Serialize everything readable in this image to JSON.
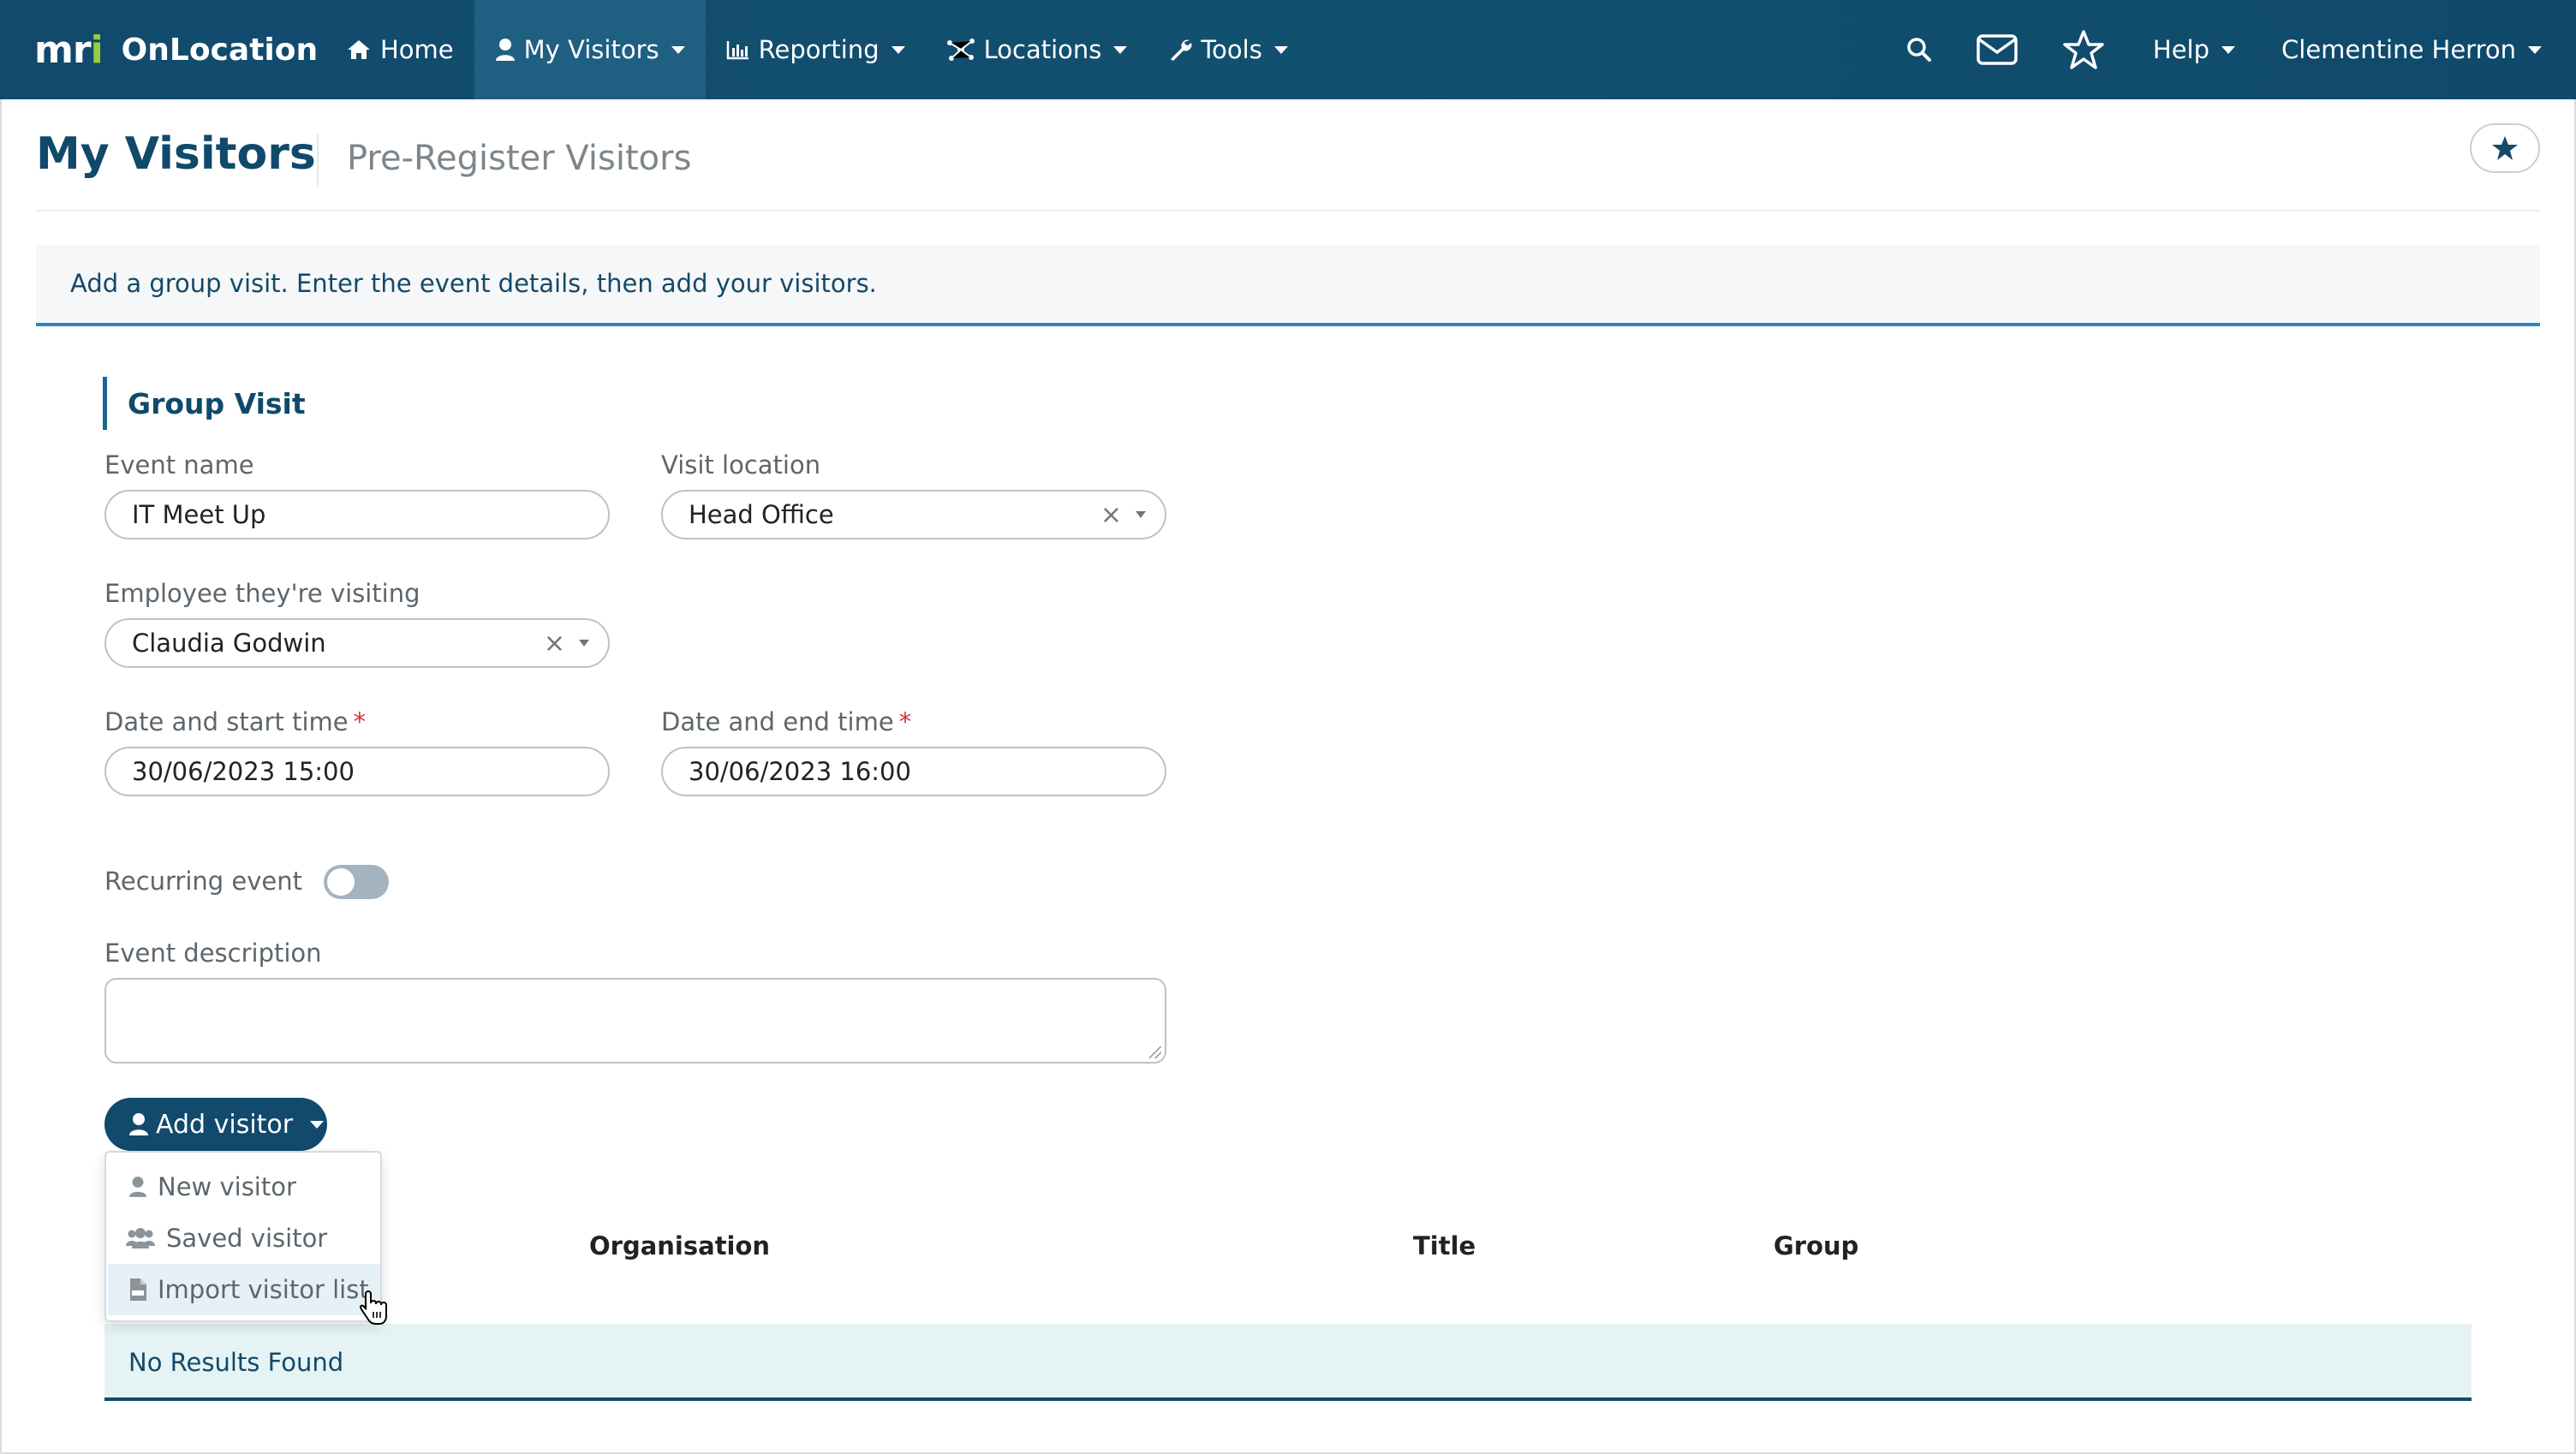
{
  "brand": {
    "logo_text": "mri",
    "name": "OnLocation"
  },
  "nav": {
    "items": [
      {
        "label": "Home",
        "icon": "home-icon"
      },
      {
        "label": "My Visitors",
        "icon": "user-icon",
        "active": true
      },
      {
        "label": "Reporting",
        "icon": "bar-chart-icon"
      },
      {
        "label": "Locations",
        "icon": "network-icon"
      },
      {
        "label": "Tools",
        "icon": "wrench-icon"
      }
    ],
    "help_label": "Help",
    "user_label": "Clementine Herron"
  },
  "header": {
    "title": "My Visitors",
    "subtitle": "Pre-Register Visitors"
  },
  "banner": {
    "text": "Add a group visit. Enter the event details, then add your visitors."
  },
  "form": {
    "section_title": "Group Visit",
    "event_name": {
      "label": "Event name",
      "value": "IT Meet Up"
    },
    "visit_location": {
      "label": "Visit location",
      "value": "Head Office"
    },
    "employee": {
      "label": "Employee they're visiting",
      "value": "Claudia Godwin"
    },
    "start": {
      "label": "Date and start time",
      "required_mark": "*",
      "value": "30/06/2023 15:00"
    },
    "end": {
      "label": "Date and end time",
      "required_mark": "*",
      "value": "30/06/2023 16:00"
    },
    "recurring": {
      "label": "Recurring event",
      "on": false
    },
    "description": {
      "label": "Event description",
      "value": ""
    }
  },
  "add_visitor": {
    "label": "Add visitor",
    "menu": [
      {
        "label": "New visitor",
        "icon": "user-icon"
      },
      {
        "label": "Saved visitor",
        "icon": "users-icon"
      },
      {
        "label": "Import visitor list",
        "icon": "csv-file-icon"
      }
    ]
  },
  "table": {
    "columns": [
      "Organisation",
      "Title",
      "Group"
    ],
    "empty_text": "No Results Found"
  },
  "colors": {
    "navbar": "#114a6d",
    "accent": "#2a86bd",
    "primary_button": "#114a6d",
    "required": "#d0343a",
    "empty_row_bg": "#e6f3f5"
  }
}
